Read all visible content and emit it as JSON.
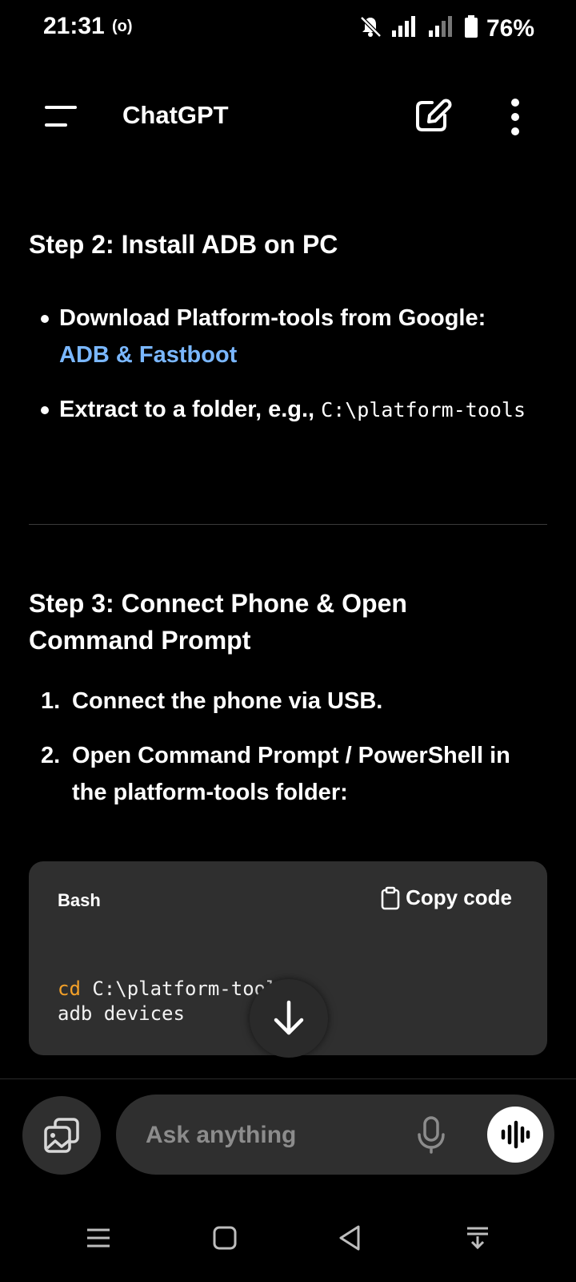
{
  "status_bar": {
    "time": "21:31",
    "radio_indicator": "(o)",
    "battery_percent": "76%",
    "icons": [
      "mute-bell-icon",
      "signal-icon",
      "signal-icon",
      "battery-icon"
    ]
  },
  "app_bar": {
    "title": "ChatGPT",
    "icons": [
      "menu-icon",
      "new-chat-icon",
      "more-vertical-icon"
    ]
  },
  "message": {
    "step2": {
      "title": "Step 2: Install ADB on PC",
      "bullets": [
        {
          "text": "Download Platform-tools from Google:",
          "link": "ADB & Fastboot"
        },
        {
          "text": "Extract to a folder, e.g., ",
          "code": "C:\\platform-tools"
        }
      ]
    },
    "step3": {
      "title": "Step 3: Connect Phone & Open Command Prompt",
      "items": [
        {
          "num": "1.",
          "text": "Connect the phone via USB."
        },
        {
          "num": "2.",
          "text": "Open Command Prompt / PowerShell in the platform-tools folder:"
        }
      ]
    },
    "code_block": {
      "language": "Bash",
      "copy_label": "Copy code",
      "line1_keyword": "cd",
      "line1_rest": " C:\\platform-tools",
      "line2": "adb devices"
    }
  },
  "composer": {
    "placeholder": "Ask anything",
    "icons": [
      "attach-image-icon",
      "mic-icon",
      "voice-mode-icon"
    ]
  },
  "nav_bar": {
    "icons": [
      "recent-apps-icon",
      "home-icon",
      "back-icon",
      "notification-pull-icon"
    ]
  },
  "colors": {
    "background": "#000000",
    "surface": "#2f2f2f",
    "link": "#7ab7ff",
    "code_keyword": "#f3a028"
  }
}
